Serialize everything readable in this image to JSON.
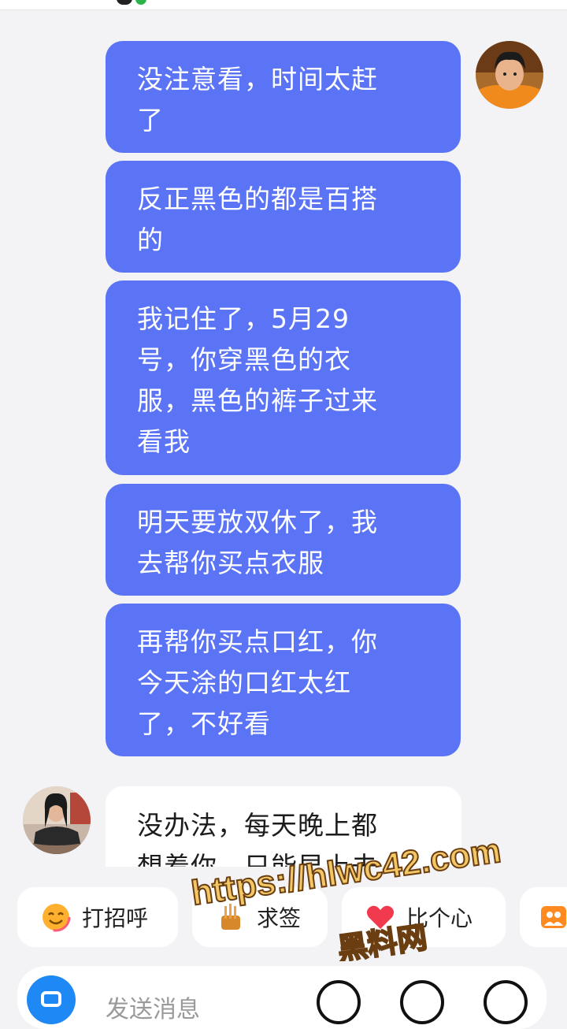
{
  "chat": {
    "messages": [
      {
        "sender": "me",
        "lines": [
          "没注意看，时间太赶",
          "了"
        ]
      },
      {
        "sender": "me",
        "lines": [
          "反正黑色的都是百搭",
          "的"
        ]
      },
      {
        "sender": "me",
        "lines": [
          "我记住了，5月29",
          "号，你穿黑色的衣",
          "服，黑色的裤子过来",
          "看我"
        ]
      },
      {
        "sender": "me",
        "lines": [
          "明天要放双休了，我",
          "去帮你买点衣服"
        ]
      },
      {
        "sender": "me",
        "lines": [
          "再帮你买点口红，你",
          "今天涂的口红太红",
          "了，不好看"
        ]
      },
      {
        "sender": "peer",
        "lines": [
          "没办法，每天晚上都",
          "想着你，只能早上去"
        ]
      }
    ]
  },
  "quick_actions": [
    {
      "label": "打招呼",
      "icon": "smile-emoji-icon"
    },
    {
      "label": "求签",
      "icon": "fortune-stick-icon"
    },
    {
      "label": "比个心",
      "icon": "heart-icon"
    },
    {
      "label": "",
      "icon": "group-photo-icon"
    }
  ],
  "watermark": {
    "url": "https://hlwc42.com",
    "name": "黑料网"
  },
  "input": {
    "placeholder": "发送消息",
    "icons": [
      "camera-icon",
      "voice-icon",
      "emoji-icon",
      "plus-icon"
    ]
  },
  "colors": {
    "my_bubble": "#5b74f5",
    "peer_bubble": "#ffffff",
    "background": "#f3f3f5"
  }
}
